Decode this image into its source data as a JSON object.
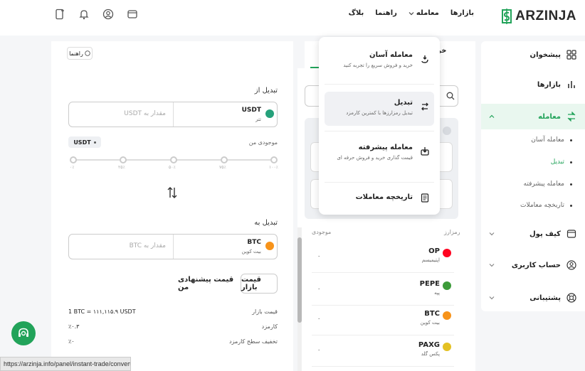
{
  "brand": {
    "name": "ARZINJA",
    "accent": "#22a35a"
  },
  "nav": {
    "markets": "بازارها",
    "trade": "معامله",
    "guide": "راهنما",
    "blog": "بلاگ"
  },
  "top_icons": [
    "wallet-icon",
    "user-icon",
    "bell-icon",
    "mobile-icon"
  ],
  "sidebar": {
    "items": [
      {
        "label": "پیشخوان",
        "icon": "dashboard-icon"
      },
      {
        "label": "بازارها",
        "icon": "chart-icon"
      },
      {
        "label": "معامله",
        "icon": "exchange-icon"
      },
      {
        "label": "کیف پول",
        "icon": "wallet-icon"
      },
      {
        "label": "حساب کاربری",
        "icon": "user-icon"
      },
      {
        "label": "پشتیبانی",
        "icon": "support-icon"
      }
    ],
    "sub_items": [
      {
        "label": "معامله آسان"
      },
      {
        "label": "تبدیل"
      },
      {
        "label": "معامله پیشرفته"
      },
      {
        "label": "تاریخچه معاملات"
      }
    ]
  },
  "dropdown": {
    "items": [
      {
        "title": "معامله آسان",
        "desc": "خرید و فروش سریع را تجربه کنید",
        "icon": "easy-trade-icon"
      },
      {
        "title": "تبدیل",
        "desc": "تبدیل رمزارزها با کمترین کارمزد",
        "icon": "convert-icon"
      },
      {
        "title": "معامله پیشرفته",
        "desc": "قیمت گذاری خرید و فروش حرفه ای",
        "icon": "advanced-trade-icon"
      },
      {
        "title": "تاریخچه معاملات",
        "desc": "",
        "icon": "history-icon"
      }
    ]
  },
  "list": {
    "tab_fragment": "خر",
    "col_asset": "رمزارز",
    "col_balance": "موجودی",
    "rows": [
      {
        "symbol": "OP",
        "name": "اپتیمیسم",
        "balance": "۰",
        "color": "#ff0420"
      },
      {
        "symbol": "PEPE",
        "name": "پپه",
        "balance": "۰",
        "color": "#3d9b3a"
      },
      {
        "symbol": "BTC",
        "name": "بیت کوین",
        "balance": "۰",
        "color": "#f7931a"
      },
      {
        "symbol": "PAXG",
        "name": "پکس گلد",
        "balance": "۰",
        "color": "#e4c123"
      }
    ]
  },
  "convert": {
    "guide_btn": "راهنما",
    "from_label": "تبدیل از",
    "from_symbol": "USDT",
    "from_name": "تتر",
    "from_placeholder": "مقدار به USDT",
    "balance_label": "موجودی من",
    "balance_unit": "USDT",
    "slider_ticks": [
      "۰٪",
      "۲۵٪",
      "۵۰٪",
      "۷۵٪",
      "۱۰۰٪"
    ],
    "to_label": "تبدیل به",
    "to_symbol": "BTC",
    "to_name": "بیت کوین",
    "to_placeholder": "مقدار به BTC",
    "market_price_btn": "قیمت بازار",
    "proposed_price_btn": "قیمت پیشنهادی من",
    "info": [
      {
        "label": "قیمت بازار",
        "value": "1 BTC = ۱۱۱,۱۱۵.۹ USDT"
      },
      {
        "label": "کارمزد",
        "value": "٪۰.۳"
      },
      {
        "label": "تخفیف سطح کارمزد",
        "value": "٪۰"
      }
    ]
  },
  "status_url": "https://arzinja.info/panel/instant-trade/convert"
}
